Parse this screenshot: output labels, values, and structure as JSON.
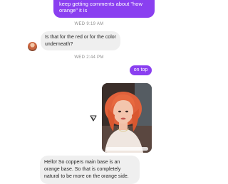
{
  "colors": {
    "outgoing": "#8a3ff0",
    "incoming": "#efefef",
    "timestamp": "#8e8e8e",
    "text": "#262626"
  },
  "thread": {
    "top_outgoing_line1": "keep getting comments about \"how",
    "top_outgoing_line2": "orange\" it is",
    "timestamp_1": "WED 9:19 AM",
    "incoming_q_line1": "Is that for the red or for the color",
    "incoming_q_line2": "underneath?",
    "timestamp_2": "WED 2:44 PM",
    "outgoing_short": "on top",
    "share_icon": "send-icon",
    "reply_line1": "Hello! So coppers main base is an",
    "reply_line2": "orange base. So that is completely",
    "reply_line3": "natural to be more on the orange side."
  }
}
